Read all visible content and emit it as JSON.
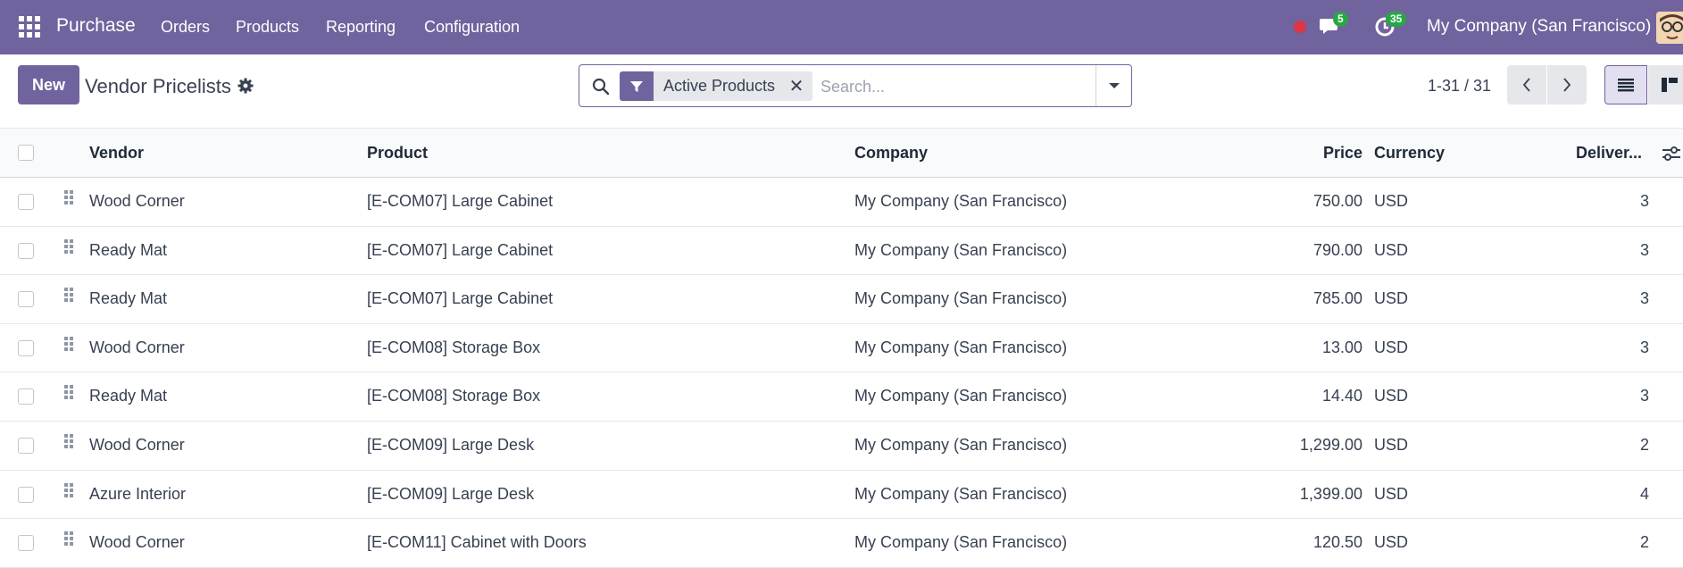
{
  "navbar": {
    "brand": "Purchase",
    "menu": [
      "Orders",
      "Products",
      "Reporting",
      "Configuration"
    ],
    "messages_count": "5",
    "activities_count": "35",
    "company": "My Company (San Francisco)"
  },
  "control": {
    "new_label": "New",
    "title": "Vendor Pricelists",
    "facet_label": "Active Products",
    "search_placeholder": "Search...",
    "pager": "1-31 / 31"
  },
  "table": {
    "headers": {
      "vendor": "Vendor",
      "product": "Product",
      "company": "Company",
      "price": "Price",
      "currency": "Currency",
      "delivery": "Deliver..."
    },
    "rows": [
      {
        "vendor": "Wood Corner",
        "product": "[E-COM07] Large Cabinet",
        "company": "My Company (San Francisco)",
        "price": "750.00",
        "currency": "USD",
        "delivery": "3"
      },
      {
        "vendor": "Ready Mat",
        "product": "[E-COM07] Large Cabinet",
        "company": "My Company (San Francisco)",
        "price": "790.00",
        "currency": "USD",
        "delivery": "3"
      },
      {
        "vendor": "Ready Mat",
        "product": "[E-COM07] Large Cabinet",
        "company": "My Company (San Francisco)",
        "price": "785.00",
        "currency": "USD",
        "delivery": "3"
      },
      {
        "vendor": "Wood Corner",
        "product": "[E-COM08] Storage Box",
        "company": "My Company (San Francisco)",
        "price": "13.00",
        "currency": "USD",
        "delivery": "3"
      },
      {
        "vendor": "Ready Mat",
        "product": "[E-COM08] Storage Box",
        "company": "My Company (San Francisco)",
        "price": "14.40",
        "currency": "USD",
        "delivery": "3"
      },
      {
        "vendor": "Wood Corner",
        "product": "[E-COM09] Large Desk",
        "company": "My Company (San Francisco)",
        "price": "1,299.00",
        "currency": "USD",
        "delivery": "2"
      },
      {
        "vendor": "Azure Interior",
        "product": "[E-COM09] Large Desk",
        "company": "My Company (San Francisco)",
        "price": "1,399.00",
        "currency": "USD",
        "delivery": "4"
      },
      {
        "vendor": "Wood Corner",
        "product": "[E-COM11] Cabinet with Doors",
        "company": "My Company (San Francisco)",
        "price": "120.50",
        "currency": "USD",
        "delivery": "2"
      }
    ]
  },
  "colors": {
    "brand": "#71639e",
    "badge": "#28a745",
    "record_dot": "#dc3545"
  }
}
